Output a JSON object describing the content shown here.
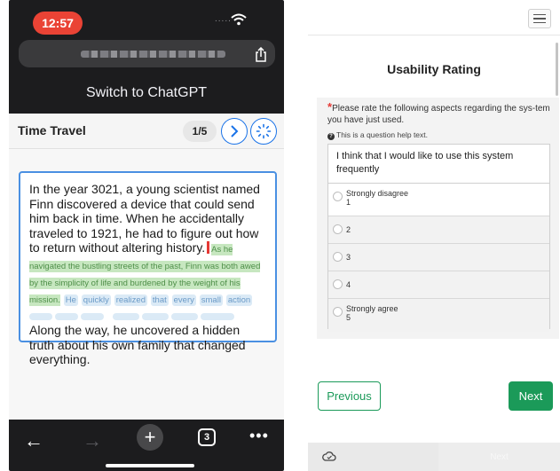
{
  "status_bar": {
    "time": "12:57"
  },
  "browser": {
    "switch_text": "Switch to ChatGPT",
    "tab_count": "3",
    "icons": [
      "wifi-icon",
      "share-icon",
      "back-arrow-icon",
      "forward-arrow-icon",
      "plus-icon",
      "tabs-icon",
      "more-icon"
    ]
  },
  "story": {
    "title": "Time Travel",
    "page_indicator": "1/5",
    "text_main": "In the year 3021, a young scientist named Finn discovered a device that could send him back in time. When he accidentally traveled to 1921, he had to figure out how to return without altering history.",
    "text_suggested": "As he navigated the bustling streets of the past, Finn was both awed by the simplicity of life and burdened by the weight of his mission.",
    "text_pending_words": [
      "He",
      "quickly",
      "realized",
      "that",
      "every",
      "small",
      "action"
    ],
    "text_end": "Along the way, he uncovered a hidden truth about his own family that changed everything."
  },
  "survey": {
    "title": "Usability Rating",
    "question": "Please rate the following aspects regarding the sys-tem you have just used.",
    "help": "This is a question help text.",
    "statement": "I think that I would like to use this system frequently",
    "options": [
      {
        "label": "Strongly disagree",
        "value": "1"
      },
      {
        "label": "",
        "value": "2"
      },
      {
        "label": "",
        "value": "3"
      },
      {
        "label": "",
        "value": "4"
      },
      {
        "label": "Strongly agree",
        "value": "5"
      }
    ],
    "prev_label": "Previous",
    "next_label": "Next",
    "footer_next_label": "Next"
  },
  "colors": {
    "accent_blue": "#1a73e8",
    "survey_green": "#1b9a59",
    "recording_red": "#ea4335",
    "highlight_green": "#c7e7c0",
    "highlight_blue": "#dbeaf6"
  }
}
